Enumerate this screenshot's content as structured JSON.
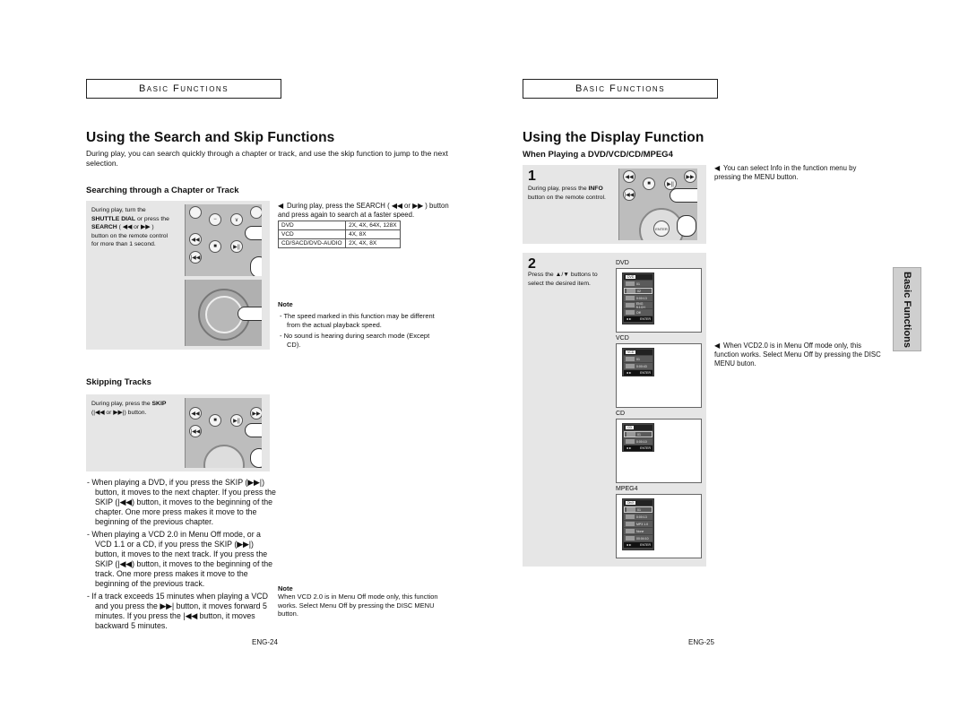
{
  "left_page": {
    "header": "Basic Functions",
    "title": "Using the Search and Skip Functions",
    "intro": "During play, you can search quickly through a chapter or track, and use the skip function to jump to the next selection.",
    "search_section": {
      "heading": "Searching through a Chapter or Track",
      "panel_text_pre": "During play, turn the ",
      "panel_text_bold1": "SHUTTLE DIAL",
      "panel_text_mid": " or press the ",
      "panel_text_bold2": "SEARCH",
      "panel_text_post": " ( ◀◀ or ▶▶ ) button on the remote control for more than 1 second.",
      "instruction": "During play, press the SEARCH ( ◀◀ or ▶▶ ) button and press again to search at a faster speed.",
      "speed_table": [
        {
          "disc": "DVD",
          "speeds": "2X, 4X, 64X, 128X"
        },
        {
          "disc": "VCD",
          "speeds": "4X, 8X"
        },
        {
          "disc": "CD/SACD/DVD-AUDIO",
          "speeds": "2X, 4X, 8X"
        }
      ],
      "note_title": "Note",
      "notes": [
        "The speed marked in this function may be different from the actual playback speed.",
        "No sound is hearing during search mode (Except CD)."
      ]
    },
    "skip_section": {
      "heading": "Skipping Tracks",
      "panel_text_pre": "During play, press the ",
      "panel_text_bold": "SKIP",
      "panel_text_post": "(|◀◀ or ▶▶|) button.",
      "bullets": [
        "When playing a DVD, if you press the SKIP (▶▶|) button, it moves to the next chapter. If you press the SKIP (|◀◀) button, it moves to the beginning of the chapter. One more press makes it move to the beginning of the previous chapter.",
        "When playing a VCD 2.0 in Menu Off mode, or a VCD 1.1 or a CD, if you press the SKIP (▶▶|) button, it moves to the next track. If you press the SKIP (|◀◀) button, it moves to the beginning of the track. One more press makes it move to the beginning of the previous track.",
        "If a track exceeds 15 minutes when playing a VCD and you press the ▶▶| button, it moves forward 5 minutes. If you press the |◀◀ button, it moves backward 5 minutes."
      ],
      "note_title": "Note",
      "note_text": "When VCD 2.0 is in Menu Off mode only, this function works. Select Menu Off by pressing the DISC MENU button."
    },
    "page_number": "ENG-24"
  },
  "right_page": {
    "header": "Basic Functions",
    "title": "Using the Display Function",
    "subtitle": "When Playing a DVD/VCD/CD/MPEG4",
    "step1": {
      "number": "1",
      "text_pre": "During play, press the ",
      "text_bold": "INFO",
      "text_post": " button on the remote control.",
      "side_note": "You can select Info in the function menu by pressing the MENU button."
    },
    "step2": {
      "number": "2",
      "text": "Press the ▲/▼ buttons to select the desired item.",
      "screens": [
        {
          "label": "DVD",
          "osd_title": "DVD",
          "rows": [
            "01",
            "02",
            "0:00:13",
            "ENG 5.1CH",
            "Off"
          ],
          "footer_left": "◄►",
          "footer_right": "ENTER"
        },
        {
          "label": "VCD",
          "osd_title": "VCD",
          "rows": [
            "01",
            "0:00:43"
          ],
          "footer_left": "◄►",
          "footer_right": "ENTER"
        },
        {
          "label": "CD",
          "osd_title": "CD",
          "rows": [
            "01",
            "0:00:10"
          ],
          "footer_left": "◄►",
          "footer_right": "ENTER"
        },
        {
          "label": "MPEG4",
          "osd_title": "DivX",
          "rows": [
            "01",
            "0:00:13",
            "MP3 1.0",
            "None",
            "00:04:10"
          ],
          "footer_left": "◄►",
          "footer_right": "ENTER"
        }
      ],
      "side_note": "When VCD2.0 is in Menu Off mode only, this function works. Select Menu Off by pressing the DISC MENU buton."
    },
    "side_tab": "Basic Functions",
    "page_number": "ENG-25"
  },
  "remote_labels": {
    "stop": "■",
    "play_pause": "▶||",
    "prev": "|◀◀",
    "next": "▶▶|",
    "rew": "◀◀",
    "ff": "▶▶",
    "enter": "ENTER"
  }
}
